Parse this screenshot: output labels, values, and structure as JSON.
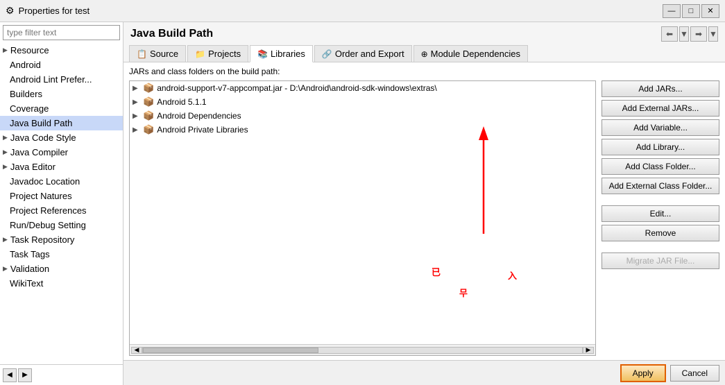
{
  "titleBar": {
    "title": "Properties for test",
    "iconLabel": "eclipse-icon",
    "minimizeLabel": "—",
    "maximizeLabel": "□",
    "closeLabel": "✕"
  },
  "sidebar": {
    "filterPlaceholder": "type filter text",
    "items": [
      {
        "label": "Resource",
        "hasArrow": true,
        "selected": false
      },
      {
        "label": "Android",
        "hasArrow": false,
        "selected": false
      },
      {
        "label": "Android Lint Prefer...",
        "hasArrow": false,
        "selected": false
      },
      {
        "label": "Builders",
        "hasArrow": false,
        "selected": false
      },
      {
        "label": "Coverage",
        "hasArrow": false,
        "selected": false
      },
      {
        "label": "Java Build Path",
        "hasArrow": false,
        "selected": true
      },
      {
        "label": "Java Code Style",
        "hasArrow": true,
        "selected": false
      },
      {
        "label": "Java Compiler",
        "hasArrow": true,
        "selected": false
      },
      {
        "label": "Java Editor",
        "hasArrow": true,
        "selected": false
      },
      {
        "label": "Javadoc Location",
        "hasArrow": false,
        "selected": false
      },
      {
        "label": "Project Natures",
        "hasArrow": false,
        "selected": false
      },
      {
        "label": "Project References",
        "hasArrow": false,
        "selected": false
      },
      {
        "label": "Run/Debug Setting",
        "hasArrow": false,
        "selected": false
      },
      {
        "label": "Task Repository",
        "hasArrow": true,
        "selected": false
      },
      {
        "label": "Task Tags",
        "hasArrow": false,
        "selected": false
      },
      {
        "label": "Validation",
        "hasArrow": true,
        "selected": false
      },
      {
        "label": "WikiText",
        "hasArrow": false,
        "selected": false
      }
    ]
  },
  "contentHeader": {
    "title": "Java Build Path"
  },
  "tabs": [
    {
      "label": "Source",
      "icon": "📋",
      "active": false
    },
    {
      "label": "Projects",
      "icon": "📁",
      "active": false
    },
    {
      "label": "Libraries",
      "icon": "📚",
      "active": true
    },
    {
      "label": "Order and Export",
      "icon": "🔗",
      "active": false
    },
    {
      "label": "Module Dependencies",
      "icon": "⊕",
      "active": false
    }
  ],
  "buildPath": {
    "description": "JARs and class folders on the build path:",
    "treeItems": [
      {
        "label": "android-support-v7-appcompat.jar - D:\\Android\\android-sdk-windows\\extras\\",
        "hasArrow": true,
        "indent": 0
      },
      {
        "label": "Android 5.1.1",
        "hasArrow": true,
        "indent": 0
      },
      {
        "label": "Android Dependencies",
        "hasArrow": true,
        "indent": 0
      },
      {
        "label": "Android Private Libraries",
        "hasArrow": true,
        "indent": 0
      }
    ],
    "buttons": [
      {
        "label": "Add JARs...",
        "disabled": false,
        "id": "add-jars"
      },
      {
        "label": "Add External JARs...",
        "disabled": false,
        "id": "add-external-jars"
      },
      {
        "label": "Add Variable...",
        "disabled": false,
        "id": "add-variable"
      },
      {
        "label": "Add Library...",
        "disabled": false,
        "id": "add-library"
      },
      {
        "label": "Add Class Folder...",
        "disabled": false,
        "id": "add-class-folder"
      },
      {
        "label": "Add External Class Folder...",
        "disabled": false,
        "id": "add-external-class-folder"
      },
      {
        "label": "Edit...",
        "disabled": false,
        "id": "edit",
        "spacerBefore": true
      },
      {
        "label": "Remove",
        "disabled": false,
        "id": "remove"
      },
      {
        "label": "Migrate JAR File...",
        "disabled": true,
        "id": "migrate-jar",
        "spacerBefore": true
      }
    ]
  },
  "bottomBar": {
    "applyLabel": "Apply",
    "cancelLabel": "Cancel"
  }
}
